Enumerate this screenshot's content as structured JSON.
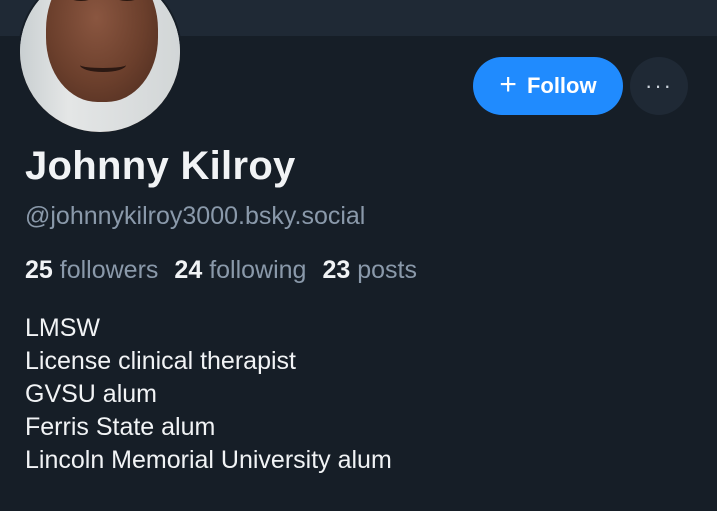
{
  "profile": {
    "display_name": "Johnny Kilroy",
    "handle": "@johnnykilroy3000.bsky.social",
    "avatar_icon": "user-avatar-photo"
  },
  "actions": {
    "follow_label": "Follow",
    "follow_icon": "plus-icon",
    "more_label": "···",
    "accent_color": "#208bfe"
  },
  "stats": {
    "followers_count": "25",
    "followers_label": "followers",
    "following_count": "24",
    "following_label": "following",
    "posts_count": "23",
    "posts_label": "posts"
  },
  "bio": {
    "lines": [
      "LMSW",
      "License clinical therapist",
      "GVSU alum",
      "Ferris State alum",
      "Lincoln Memorial University alum"
    ]
  }
}
